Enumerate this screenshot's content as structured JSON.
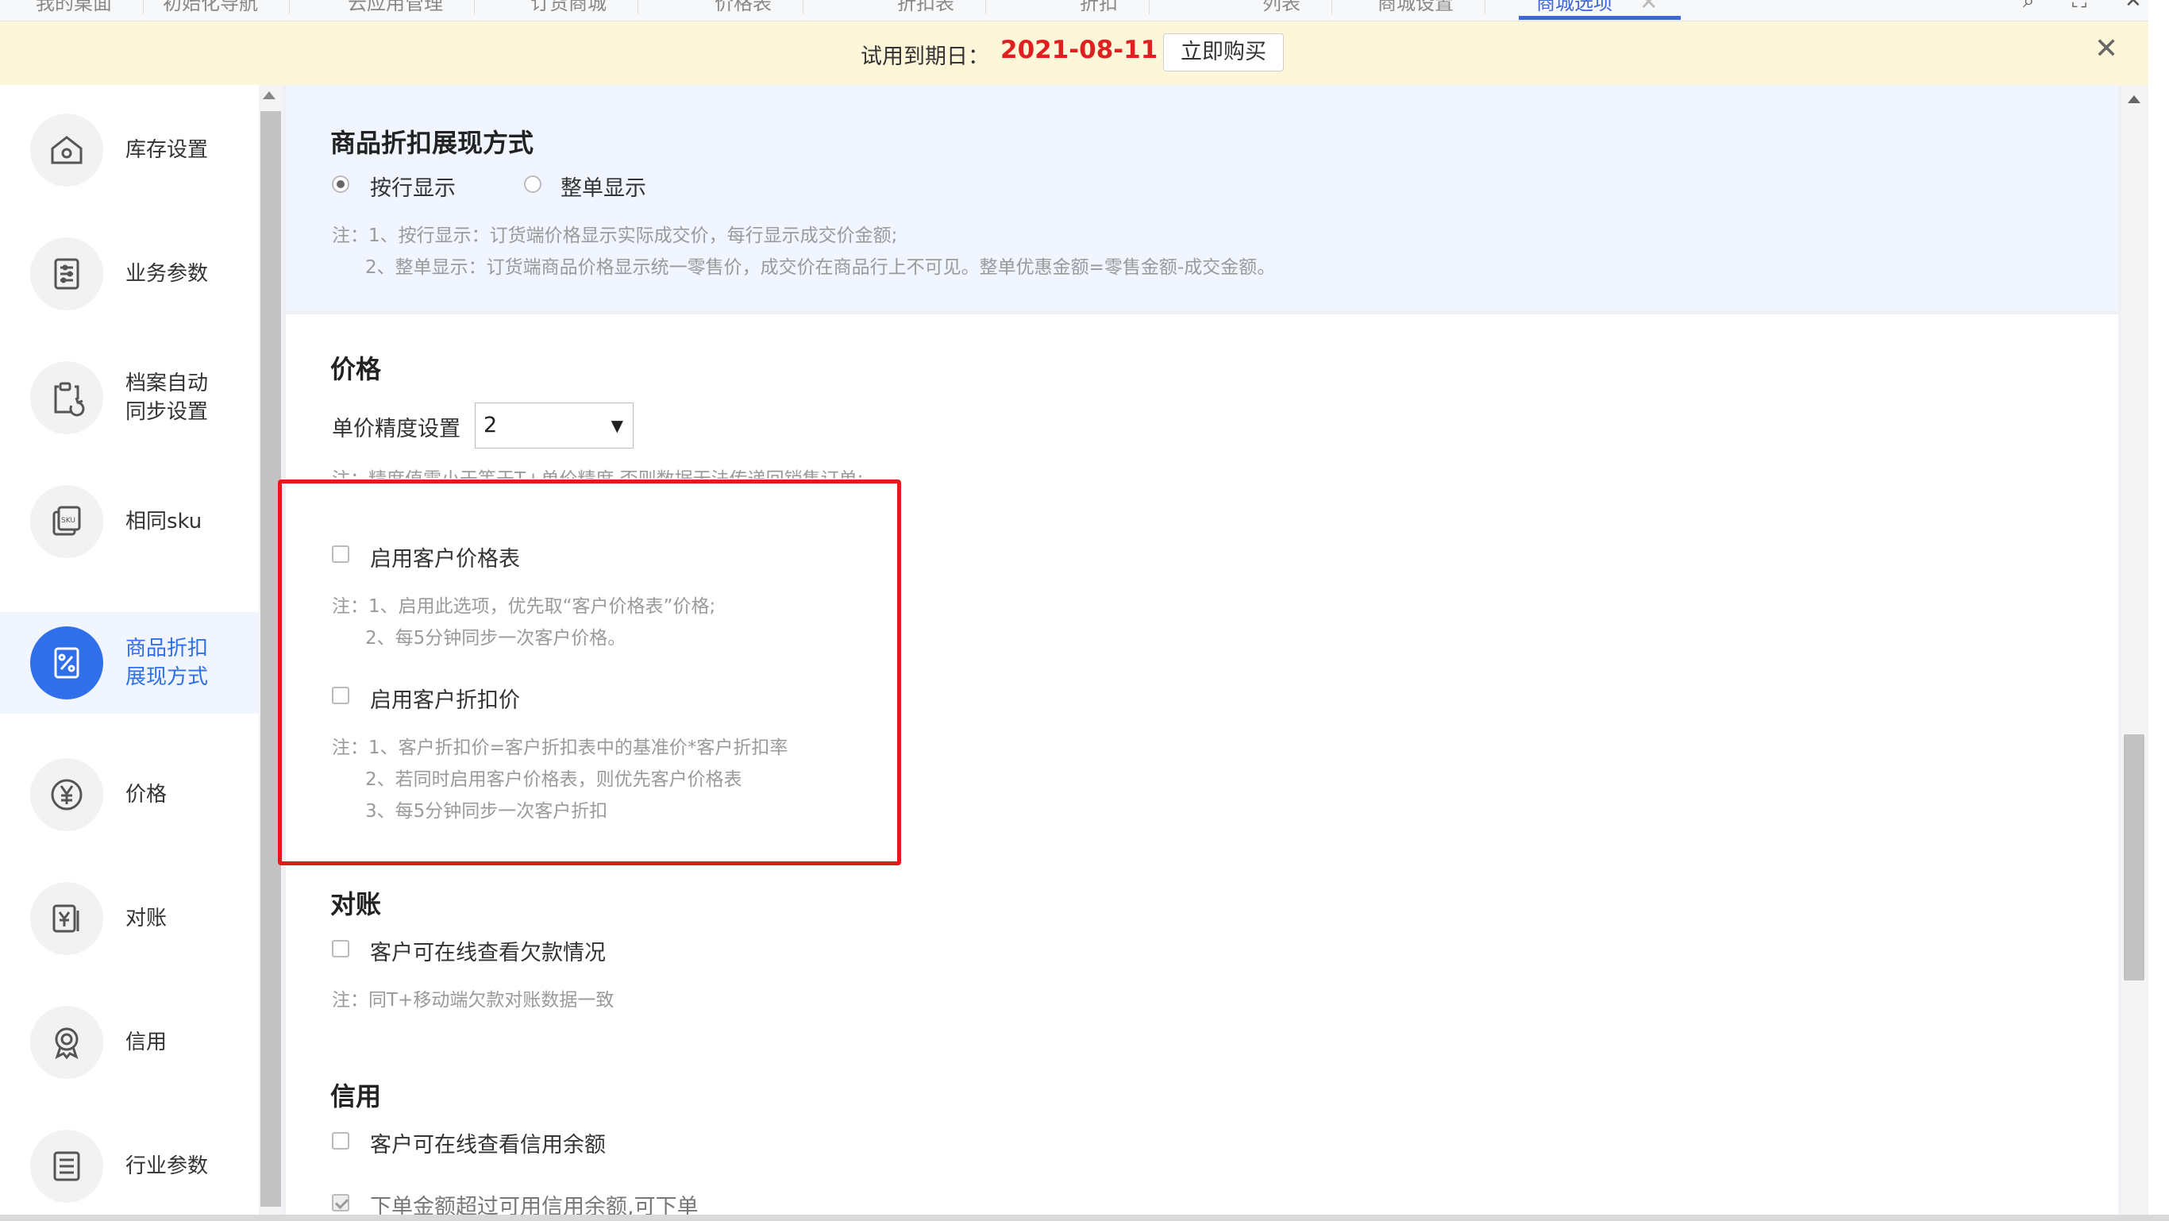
{
  "tabs": [
    {
      "label": "我的桌面"
    },
    {
      "label": "初始化导航"
    },
    {
      "label": "云应用管理"
    },
    {
      "label": "订货商城"
    },
    {
      "label": "价格表"
    },
    {
      "label": "折扣表"
    },
    {
      "label": "折扣"
    },
    {
      "label": "列表"
    },
    {
      "label": "商城设置"
    },
    {
      "label": "商城选项"
    }
  ],
  "banner": {
    "text": "试用到期日：",
    "date": "2021-08-11",
    "buy_label": "立即购买"
  },
  "sidebar": {
    "items": [
      {
        "label": "库存设置",
        "icon": "warehouse-icon"
      },
      {
        "label": "业务参数",
        "icon": "document-sliders-icon"
      },
      {
        "label_lines": [
          "档案自动",
          "同步设置"
        ],
        "icon": "clipboard-sync-icon"
      },
      {
        "label": "相同sku",
        "icon": "sku-icon"
      },
      {
        "label_lines": [
          "商品折扣",
          "展现方式"
        ],
        "icon": "percent-tag-icon",
        "active": true
      },
      {
        "label": "价格",
        "icon": "yen-icon"
      },
      {
        "label": "对账",
        "icon": "yen-ledger-icon"
      },
      {
        "label": "信用",
        "icon": "badge-icon"
      },
      {
        "label": "行业参数",
        "icon": "list-icon"
      }
    ]
  },
  "discount": {
    "title": "商品折扣展现方式",
    "options": [
      "按行显示",
      "整单显示"
    ],
    "selected": 0,
    "notes": [
      "注：1、按行显示：订货端价格显示实际成交价，每行显示成交价金额;",
      "2、整单显示：订货端商品价格显示统一零售价，成交价在商品行上不可见。整单优惠金额=零售金额-成交金额。"
    ]
  },
  "price": {
    "title": "价格",
    "precision_label": "单价精度设置",
    "precision_value": "2",
    "precision_note": "注：精度值需小于等于T+单价精度,否则数据无法传递回销售订单;",
    "customer_price_label": "启用客户价格表",
    "customer_price_notes": [
      "注：1、启用此选项，优先取“客户价格表”价格;",
      "2、每5分钟同步一次客户价格。"
    ],
    "customer_discount_label": "启用客户折扣价",
    "customer_discount_notes": [
      "注：1、客户折扣价=客户折扣表中的基准价*客户折扣率",
      "2、若同时启用客户价格表，则优先客户价格表",
      "3、每5分钟同步一次客户折扣"
    ]
  },
  "reconcile": {
    "title": "对账",
    "option_label": "客户可在线查看欠款情况",
    "note": "注：同T+移动端欠款对账数据一致"
  },
  "credit": {
    "title": "信用",
    "option1_label": "客户可在线查看信用余额",
    "option2_label": "下单金额超过可用信用余额,可下单"
  },
  "colors": {
    "accent": "#2f6fea",
    "date_red": "#e02020",
    "highlight_red": "#e01b1b",
    "banner_bg": "#fdf6d8"
  }
}
